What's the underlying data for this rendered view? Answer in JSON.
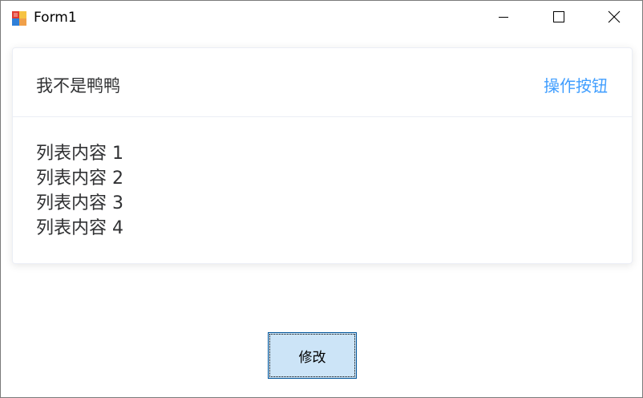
{
  "window": {
    "title": "Form1",
    "controls": {
      "minimize_icon": "minimize-icon",
      "maximize_icon": "maximize-icon",
      "close_icon": "close-icon"
    }
  },
  "card": {
    "title": "我不是鸭鸭",
    "action_label": "操作按钮",
    "items": [
      {
        "label": "列表内容 1"
      },
      {
        "label": "列表内容 2"
      },
      {
        "label": "列表内容 3"
      },
      {
        "label": "列表内容 4"
      }
    ]
  },
  "footer": {
    "modify_label": "修改"
  },
  "colors": {
    "accent": "#409eff",
    "button_bg": "#cce4f7",
    "button_border": "#005499",
    "text": "#303133",
    "divider": "#ebeef5"
  }
}
